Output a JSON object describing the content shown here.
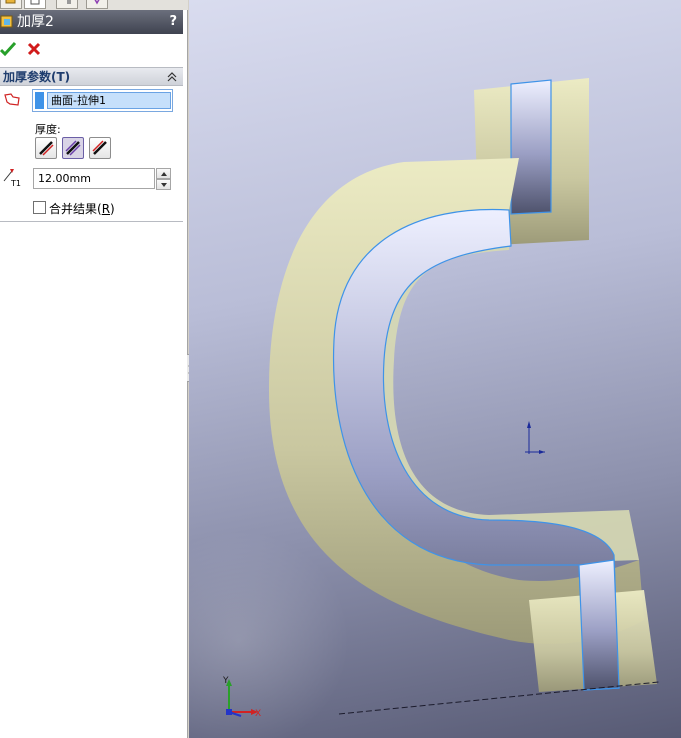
{
  "feature": {
    "title": "加厚2",
    "help": "?"
  },
  "group": {
    "title": "加厚参数(T)"
  },
  "face_list": {
    "selected_item": "曲面-拉伸1"
  },
  "thickness": {
    "label": "厚度:",
    "options": [
      "thicken-side-1",
      "thicken-both-sides",
      "thicken-side-2"
    ],
    "selected_option": "thicken-both-sides",
    "value": "12.00mm"
  },
  "merge": {
    "label": "合并结果",
    "shortcut": "R",
    "checked": false
  },
  "triad": {
    "x_label": "X",
    "y_label": "Y"
  },
  "colors": {
    "title_bar": "#4f5360",
    "selection": "#3f93e8",
    "model_surface": "#e8e6b8",
    "viewport_top": "#d9dcef",
    "viewport_bottom": "#575a74"
  }
}
